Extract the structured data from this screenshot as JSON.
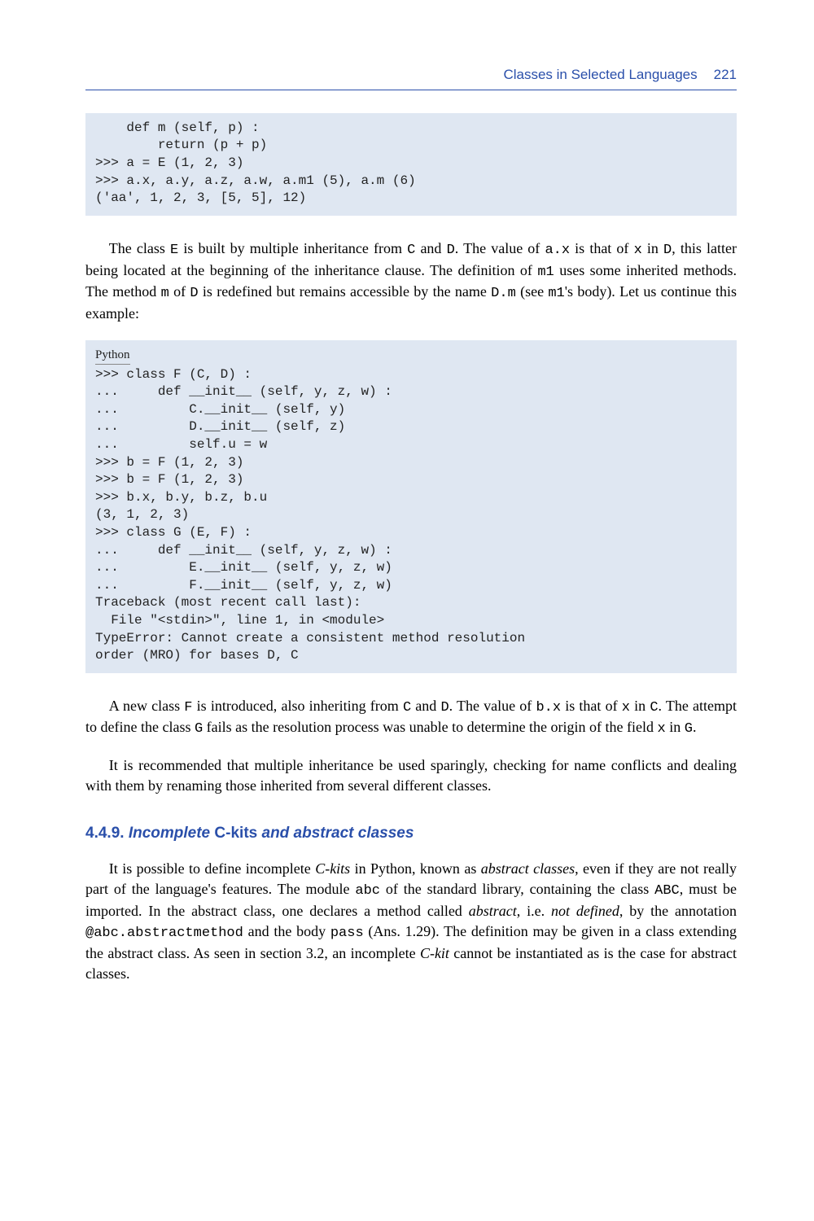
{
  "header": {
    "title": "Classes in Selected Languages",
    "page": "221"
  },
  "code1": "    def m (self, p) :\n        return (p + p)\n>>> a = E (1, 2, 3)\n>>> a.x, a.y, a.z, a.w, a.m1 (5), a.m (6)\n('aa', 1, 2, 3, [5, 5], 12)",
  "para1_a": "The class ",
  "para1_b": " is built by multiple inheritance from ",
  "para1_c": " and ",
  "para1_d": ". The value of ",
  "para1_e": " is that of ",
  "para1_f": " in ",
  "para1_g": ", this latter being located at the beginning of the inheritance clause. The definition of ",
  "para1_h": " uses some inherited methods. The method ",
  "para1_i": " of ",
  "para1_j": " is redefined but remains accessible by the name ",
  "para1_k": " (see ",
  "para1_l": "'s body). Let us continue this example:",
  "inline": {
    "E": "E",
    "C": "C",
    "D": "D",
    "ax": "a.x",
    "x": "x",
    "m1": "m1",
    "m": "m",
    "Dm": "D.m",
    "F": "F",
    "bx": "b.x",
    "G": "G",
    "abc": "abc",
    "ABC": "ABC",
    "annot": "@abc.abstractmethod",
    "pass": "pass"
  },
  "code2_lang": "Python",
  "code2": ">>> class F (C, D) :\n...     def __init__ (self, y, z, w) :\n...         C.__init__ (self, y)\n...         D.__init__ (self, z)\n...         self.u = w\n>>> b = F (1, 2, 3)\n>>> b = F (1, 2, 3)\n>>> b.x, b.y, b.z, b.u\n(3, 1, 2, 3)\n>>> class G (E, F) :\n...     def __init__ (self, y, z, w) :\n...         E.__init__ (self, y, z, w)\n...         F.__init__ (self, y, z, w)\nTraceback (most recent call last):\n  File \"<stdin>\", line 1, in <module>\nTypeError: Cannot create a consistent method resolution\norder (MRO) for bases D, C",
  "para2_a": "A new class ",
  "para2_b": " is introduced, also inheriting from ",
  "para2_c": " and ",
  "para2_d": ". The value of ",
  "para2_e": " is that of ",
  "para2_f": " in ",
  "para2_g": ". The attempt to define the class ",
  "para2_h": " fails as the resolution process was unable to determine the origin of the field ",
  "para2_i": " in ",
  "para2_j": ".",
  "para3": "It is recommended that multiple inheritance be used sparingly, checking for name conflicts and dealing with them by renaming those inherited from several different classes.",
  "section": {
    "num": "4.4.9.",
    "t1": "Incomplete",
    "t2": " C-kits ",
    "t3": "and abstract classes"
  },
  "para4_a": "It is possible to define incomplete ",
  "para4_b": "C-kits",
  "para4_c": " in Python, known as ",
  "para4_d": "abstract classes",
  "para4_e": ", even if they are not really part of the language's features. The module ",
  "para4_f": " of the standard library, containing the class ",
  "para4_g": ", must be imported. In the abstract class, one declares a method called ",
  "para4_h": "abstract",
  "para4_i": ", i.e. ",
  "para4_j": "not defined",
  "para4_k": ", by the annotation ",
  "para4_l": " and the body ",
  "para4_m": " (Ans. 1.29). The definition may be given in a class extending the abstract class. As seen in section 3.2, an incomplete ",
  "para4_n": "C-kit",
  "para4_o": " cannot be instantiated as is the case for abstract classes."
}
